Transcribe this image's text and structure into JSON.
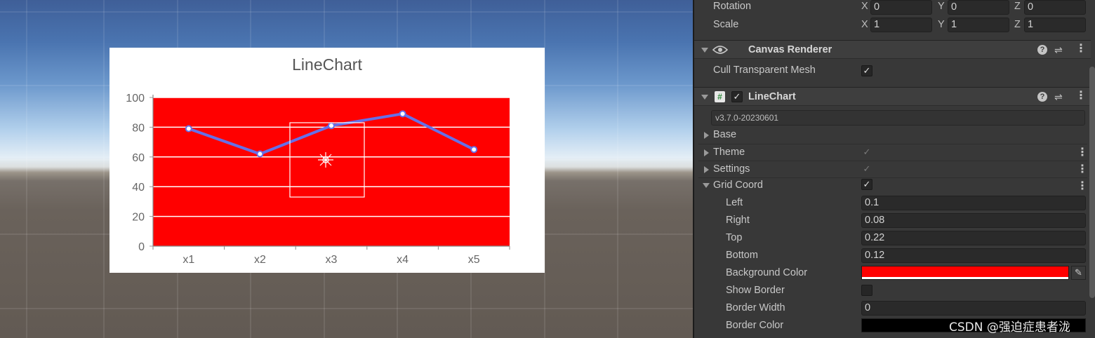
{
  "chart": {
    "title": "LineChart",
    "background_color": "#ff0000",
    "line_color": "#6670e8",
    "chart_data": {
      "type": "line",
      "title": "LineChart",
      "categories": [
        "x1",
        "x2",
        "x3",
        "x4",
        "x5"
      ],
      "series": [
        {
          "values": [
            79,
            62,
            81,
            89,
            65
          ]
        }
      ],
      "ylim": [
        0,
        100
      ],
      "yticks": [
        "0",
        "20",
        "40",
        "60",
        "80",
        "100"
      ],
      "grid": true
    }
  },
  "inspector": {
    "transform": {
      "rotation_label": "Rotation",
      "scale_label": "Scale",
      "rotation": {
        "x_label": "X",
        "x": "0",
        "y_label": "Y",
        "y": "0",
        "z_label": "Z",
        "z": "0"
      },
      "scale": {
        "x_label": "X",
        "x": "1",
        "y_label": "Y",
        "y": "1",
        "z_label": "Z",
        "z": "1"
      }
    },
    "canvas_renderer": {
      "title": "Canvas Renderer",
      "cull_label": "Cull Transparent Mesh",
      "cull_checked": true
    },
    "linechart": {
      "title": "LineChart",
      "version": "v3.7.0-20230601",
      "sections": {
        "base": "Base",
        "theme": "Theme",
        "settings": "Settings",
        "grid_coord": "Grid Coord"
      },
      "grid": {
        "left_label": "Left",
        "left": "0.1",
        "right_label": "Right",
        "right": "0.08",
        "top_label": "Top",
        "top": "0.22",
        "bottom_label": "Bottom",
        "bottom": "0.12",
        "bg_color_label": "Background Color",
        "bg_color": "#ff0000",
        "show_border_label": "Show Border",
        "show_border": false,
        "border_width_label": "Border Width",
        "border_width": "0",
        "border_color_label": "Border Color",
        "border_color": "#000000"
      }
    }
  },
  "watermark": "CSDN @强迫症患者泷"
}
